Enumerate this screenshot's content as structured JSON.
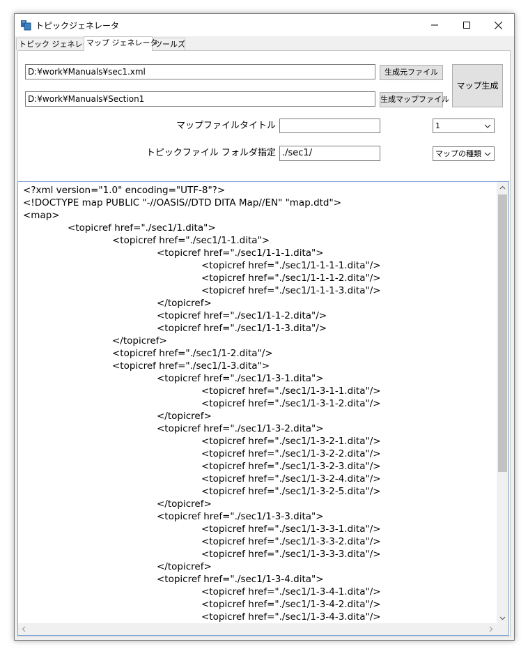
{
  "window": {
    "title": "トピックジェネレータ",
    "minimize_glyph": "—",
    "maximize_glyph": "☐",
    "close_glyph": "✕"
  },
  "tabs": [
    {
      "label": "トピック ジェネレータ",
      "active": false
    },
    {
      "label": "マップ ジェネレータ",
      "active": true
    },
    {
      "label": "ツールズ",
      "active": false
    }
  ],
  "form": {
    "source_file_path": "D:¥work¥Manuals¥sec1.xml",
    "map_file_path": "D:¥work¥Manuals¥Section1",
    "source_file_button": "生成元ファイル",
    "map_file_button": "生成マップファイル",
    "generate_button": "マップ生成",
    "map_title_label": "マップファイルタイトル",
    "map_title_value": "",
    "topic_folder_label": "トピックファイル フォルダ指定",
    "topic_folder_value": "./sec1/",
    "level_select_value": "1",
    "map_type_select_value": "マップの種類"
  },
  "editor": {
    "lines": [
      "<?xml version=\"1.0\" encoding=\"UTF-8\"?>",
      "<!DOCTYPE map PUBLIC \"-//OASIS//DTD DITA Map//EN\" \"map.dtd\">",
      "<map>",
      "\t<topicref href=\"./sec1/1.dita\">",
      "\t\t<topicref href=\"./sec1/1-1.dita\">",
      "\t\t\t<topicref href=\"./sec1/1-1-1.dita\">",
      "\t\t\t\t<topicref href=\"./sec1/1-1-1-1.dita\"/>",
      "\t\t\t\t<topicref href=\"./sec1/1-1-1-2.dita\"/>",
      "\t\t\t\t<topicref href=\"./sec1/1-1-1-3.dita\"/>",
      "\t\t\t</topicref>",
      "\t\t\t<topicref href=\"./sec1/1-1-2.dita\"/>",
      "\t\t\t<topicref href=\"./sec1/1-1-3.dita\"/>",
      "\t\t</topicref>",
      "\t\t<topicref href=\"./sec1/1-2.dita\"/>",
      "\t\t<topicref href=\"./sec1/1-3.dita\">",
      "\t\t\t<topicref href=\"./sec1/1-3-1.dita\">",
      "\t\t\t\t<topicref href=\"./sec1/1-3-1-1.dita\"/>",
      "\t\t\t\t<topicref href=\"./sec1/1-3-1-2.dita\"/>",
      "\t\t\t</topicref>",
      "\t\t\t<topicref href=\"./sec1/1-3-2.dita\">",
      "\t\t\t\t<topicref href=\"./sec1/1-3-2-1.dita\"/>",
      "\t\t\t\t<topicref href=\"./sec1/1-3-2-2.dita\"/>",
      "\t\t\t\t<topicref href=\"./sec1/1-3-2-3.dita\"/>",
      "\t\t\t\t<topicref href=\"./sec1/1-3-2-4.dita\"/>",
      "\t\t\t\t<topicref href=\"./sec1/1-3-2-5.dita\"/>",
      "\t\t\t</topicref>",
      "\t\t\t<topicref href=\"./sec1/1-3-3.dita\">",
      "\t\t\t\t<topicref href=\"./sec1/1-3-3-1.dita\"/>",
      "\t\t\t\t<topicref href=\"./sec1/1-3-3-2.dita\"/>",
      "\t\t\t\t<topicref href=\"./sec1/1-3-3-3.dita\"/>",
      "\t\t\t</topicref>",
      "\t\t\t<topicref href=\"./sec1/1-3-4.dita\">",
      "\t\t\t\t<topicref href=\"./sec1/1-3-4-1.dita\"/>",
      "\t\t\t\t<topicref href=\"./sec1/1-3-4-2.dita\"/>",
      "\t\t\t\t<topicref href=\"./sec1/1-3-4-3.dita\"/>"
    ]
  },
  "colors": {
    "accent_icon": "#2b6cb0",
    "editor_border": "#7a9fd0",
    "scroll_thumb": "#c2c2c2"
  }
}
